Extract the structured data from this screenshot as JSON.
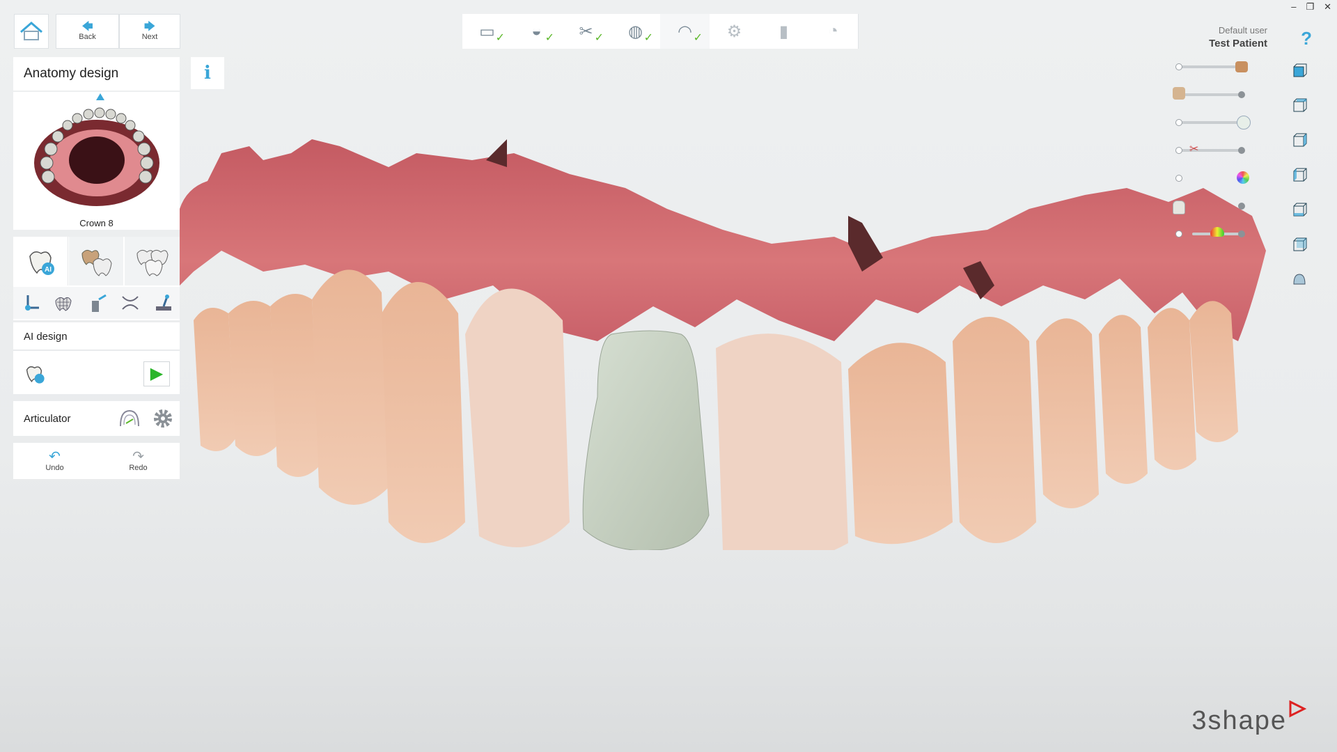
{
  "window": {
    "minimize": "–",
    "restore": "❐",
    "close": "✕"
  },
  "nav": {
    "home_icon": "home-icon",
    "back_label": "Back",
    "next_label": "Next",
    "arrow_left": "🡄",
    "arrow_right": "🡆"
  },
  "workflow_steps": [
    {
      "name": "order",
      "icon": "▭",
      "done": true
    },
    {
      "name": "scan",
      "icon": "◒",
      "done": true
    },
    {
      "name": "prep",
      "icon": "✂",
      "done": true
    },
    {
      "name": "margin",
      "icon": "◍",
      "done": true
    },
    {
      "name": "crown",
      "icon": "◠",
      "done": true,
      "active": true
    },
    {
      "name": "articulate",
      "icon": "⚙",
      "done": false
    },
    {
      "name": "implant",
      "icon": "▮",
      "done": false
    },
    {
      "name": "export",
      "icon": "◔",
      "done": false
    }
  ],
  "panel": {
    "title": "Anatomy design",
    "info_icon": "i",
    "crown_label": "Crown 8",
    "ai_design_label": "AI design",
    "ai_badge": "AI",
    "articulator_label": "Articulator",
    "undo_label": "Undo",
    "redo_label": "Redo",
    "play_icon": "▶",
    "undo_icon": "↶",
    "redo_icon": "↷"
  },
  "user": {
    "role": "Default user",
    "patient": "Test Patient",
    "help_icon": "?"
  },
  "brand": {
    "logo": "3shape"
  },
  "colors": {
    "accent": "#3aa6d8",
    "check": "#5cb82a",
    "gum": "#c9626a",
    "crown": "#c9d2c6",
    "play": "#2bb52b"
  }
}
